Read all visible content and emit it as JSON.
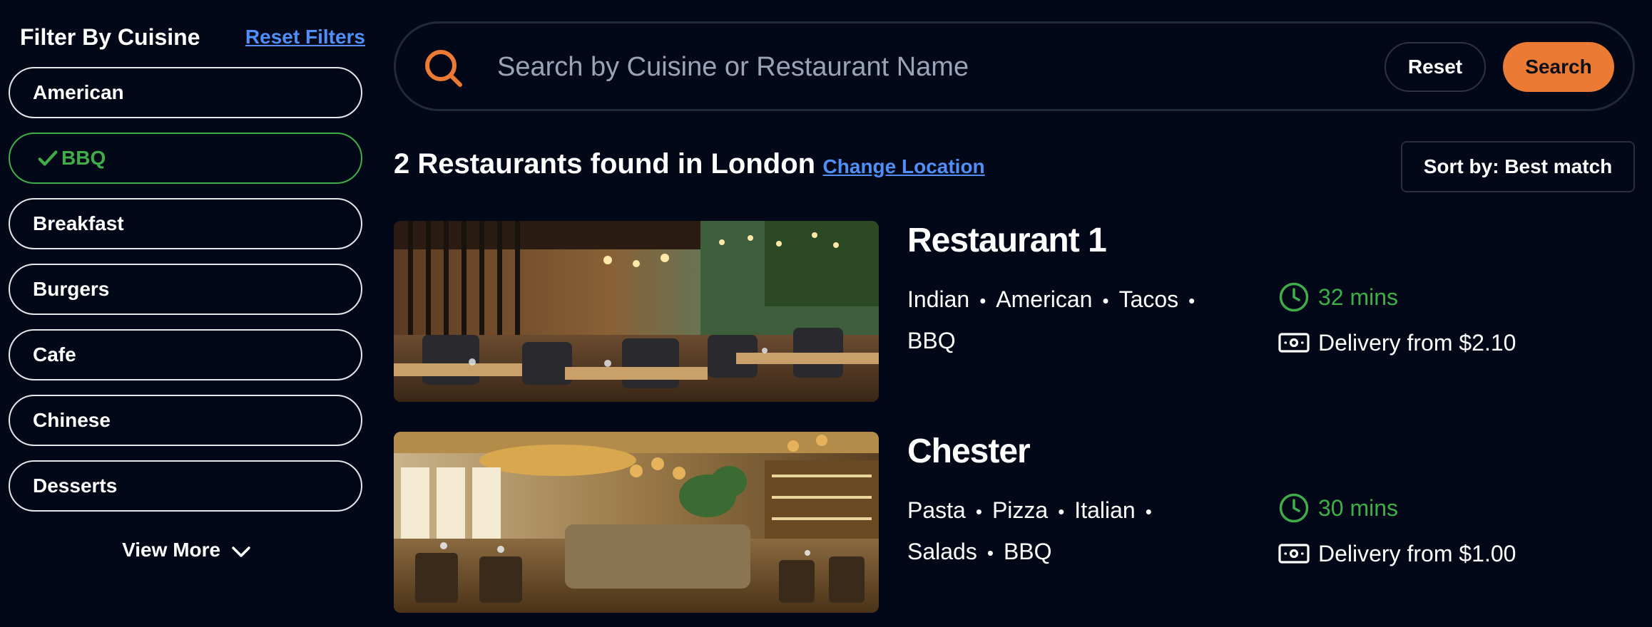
{
  "sidebar": {
    "title": "Filter By Cuisine",
    "reset_label": "Reset Filters",
    "cuisines": [
      {
        "label": "American",
        "selected": false
      },
      {
        "label": "BBQ",
        "selected": true
      },
      {
        "label": "Breakfast",
        "selected": false
      },
      {
        "label": "Burgers",
        "selected": false
      },
      {
        "label": "Cafe",
        "selected": false
      },
      {
        "label": "Chinese",
        "selected": false
      },
      {
        "label": "Desserts",
        "selected": false
      }
    ],
    "view_more_label": "View More",
    "view_more_icon": "chevron-down-icon"
  },
  "search": {
    "icon": "search-icon",
    "placeholder": "Search by Cuisine or Restaurant Name",
    "value": "",
    "reset_label": "Reset",
    "search_label": "Search"
  },
  "results": {
    "count_text": "2 Restaurants found in London",
    "change_location_label": "Change Location",
    "sort_label": "Sort by: Best match"
  },
  "restaurants": [
    {
      "name": "Restaurant 1",
      "cuisines": [
        "Indian",
        "American",
        "Tacos",
        "BBQ"
      ],
      "time": "32 mins",
      "delivery": "Delivery from $2.10"
    },
    {
      "name": "Chester",
      "cuisines": [
        "Pasta",
        "Pizza",
        "Italian",
        "Salads",
        "BBQ"
      ],
      "time": "30 mins",
      "delivery": "Delivery from $1.00"
    }
  ],
  "colors": {
    "background": "#020817",
    "accent": "#ea7a34",
    "success": "#3fae4a",
    "link": "#4f8ff7"
  }
}
